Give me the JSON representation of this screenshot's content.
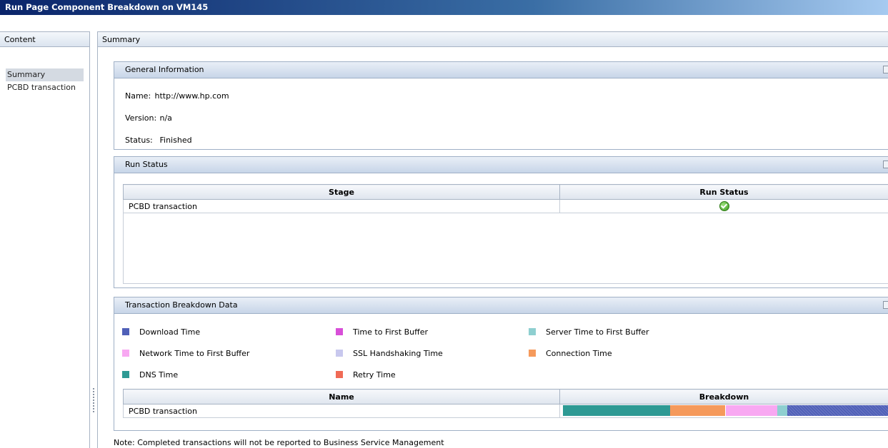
{
  "window": {
    "title": "Run Page Component Breakdown on VM145"
  },
  "left": {
    "header": "Content",
    "items": [
      {
        "label": "Summary",
        "selected": true
      },
      {
        "label": "PCBD transaction",
        "selected": false
      }
    ]
  },
  "right": {
    "header": "Summary"
  },
  "general": {
    "title": "General Information",
    "name_label": "Name:",
    "name_value": "http://www.hp.com",
    "version_label": "Version:",
    "version_value": "n/a",
    "status_label": "Status:",
    "status_value": "Finished"
  },
  "run_status": {
    "title": "Run Status",
    "columns": [
      "Stage",
      "Run Status"
    ],
    "rows": [
      {
        "stage": "PCBD transaction",
        "status_icon": "success-check-icon"
      }
    ]
  },
  "breakdown": {
    "title": "Transaction Breakdown Data",
    "legend": [
      {
        "label": "Download Time",
        "color": "#5060b8"
      },
      {
        "label": "Time to First Buffer",
        "color": "#d84fd8"
      },
      {
        "label": "Server Time to First Buffer",
        "color": "#8ecfd0"
      },
      {
        "label": "Network Time to First Buffer",
        "color": "#f8a8f2"
      },
      {
        "label": "SSL Handshaking Time",
        "color": "#c8c8ee"
      },
      {
        "label": "Connection Time",
        "color": "#f59a5c"
      },
      {
        "label": "DNS Time",
        "color": "#2e9a94"
      },
      {
        "label": "Retry Time",
        "color": "#f06a55"
      }
    ],
    "columns": [
      "Name",
      "Breakdown"
    ],
    "rows": [
      {
        "name": "PCBD transaction",
        "segments": [
          {
            "component": "DNS Time",
            "fraction": 0.33,
            "color": "#2e9a94"
          },
          {
            "component": "Connection Time",
            "fraction": 0.17,
            "color": "#f59a5c"
          },
          {
            "component": "Network Time to First Buffer",
            "fraction": 0.16,
            "color": "#f8a8f2"
          },
          {
            "component": "Server Time to First Buffer",
            "fraction": 0.03,
            "color": "#8ecfd0"
          },
          {
            "component": "Download Time",
            "fraction": 0.31,
            "color": "#5060b8"
          }
        ]
      }
    ]
  },
  "note": "Note: Completed transactions will not be reported to Business Service Management"
}
